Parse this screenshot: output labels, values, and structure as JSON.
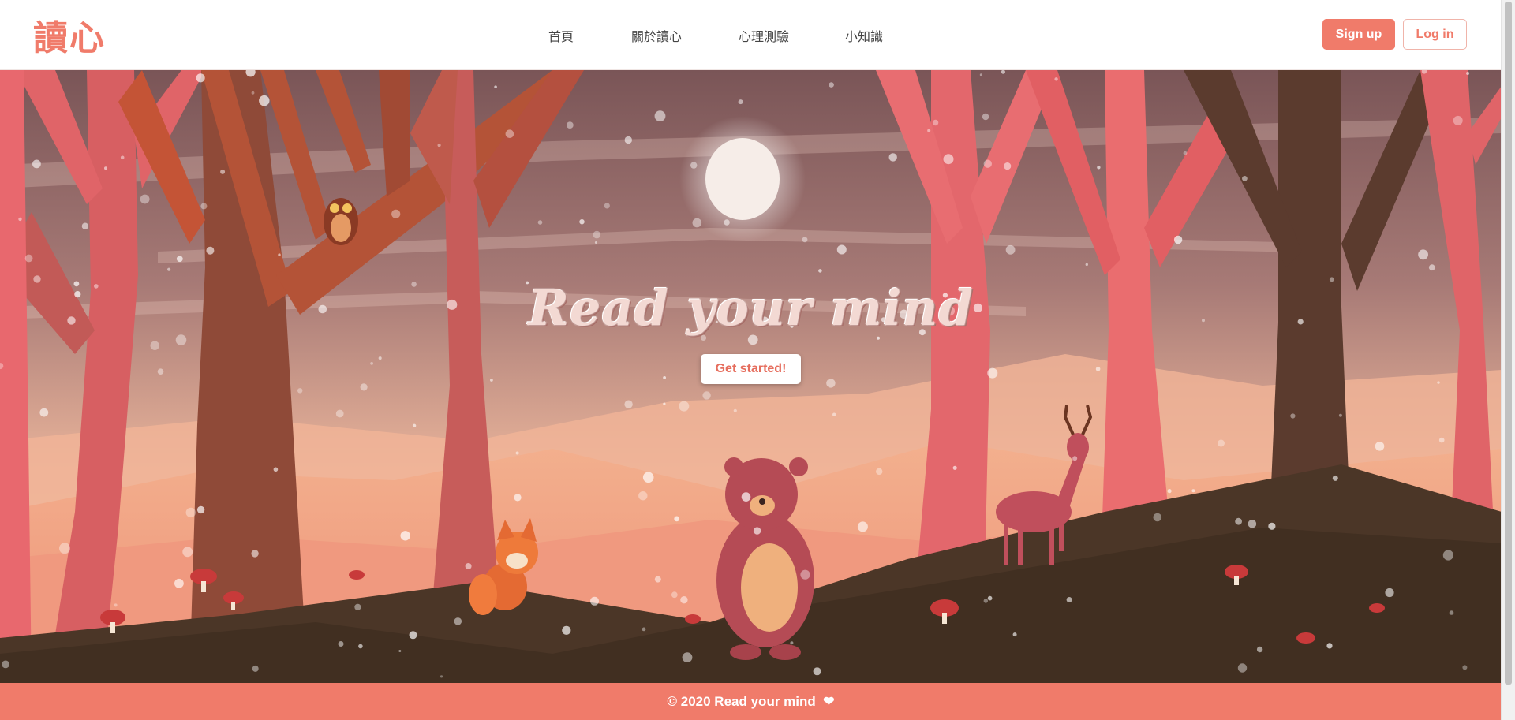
{
  "brand": {
    "logo_text": "讀心"
  },
  "nav": {
    "items": [
      {
        "label": "首頁"
      },
      {
        "label": "關於讀心"
      },
      {
        "label": "心理測驗"
      },
      {
        "label": "小知識"
      }
    ],
    "signup_label": "Sign up",
    "login_label": "Log in"
  },
  "hero": {
    "title": "Read your mind",
    "cta_label": "Get started!",
    "illustration": [
      "owl-icon",
      "fox-icon",
      "bear-icon",
      "deer-icon",
      "moon-icon",
      "mushroom-icon",
      "tree-icon",
      "snowflake-icon"
    ]
  },
  "footer": {
    "copyright": "© 2020 Read your mind",
    "heart_icon": "heart-icon"
  },
  "colors": {
    "accent": "#f07b6a",
    "sky_top": "#7a5557",
    "sky_bottom": "#f2c2a4",
    "ground": "#4a3626"
  }
}
